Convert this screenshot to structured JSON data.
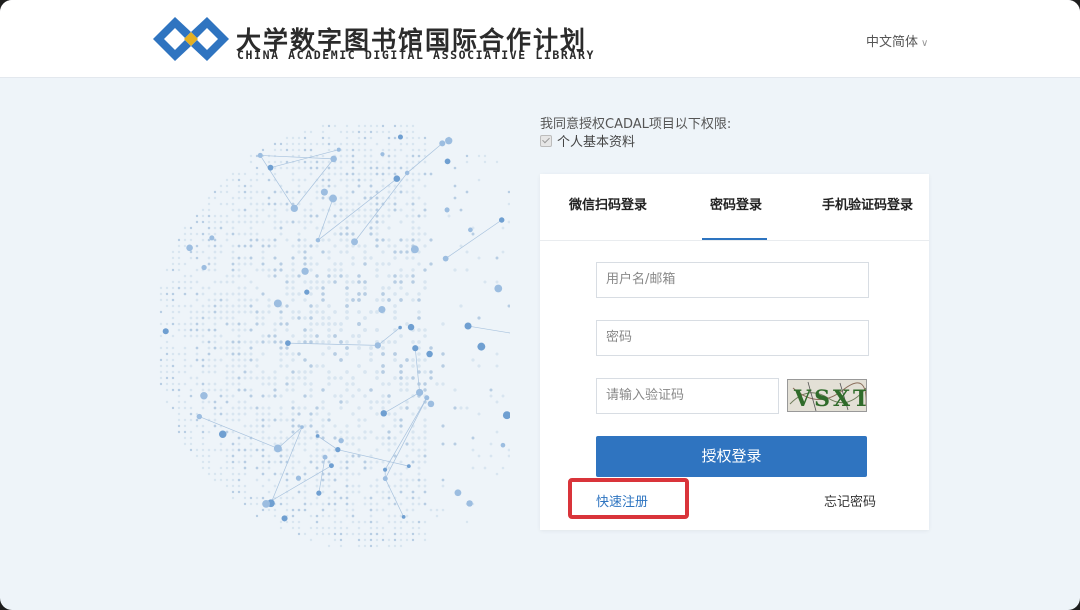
{
  "header": {
    "brand_cn": "大学数字图书馆国际合作计划",
    "brand_en": "CHINA ACADEMIC DIGITAL ASSOCIATIVE LIBRARY",
    "language": "中文简体",
    "colors": {
      "logo_blue": "#2f74c0",
      "logo_gold": "#e5b021"
    }
  },
  "consent": {
    "intro": "我同意授权CADAL项目以下权限:",
    "permission": "个人基本资料",
    "permission_checked": true
  },
  "login": {
    "tabs": [
      {
        "label": "微信扫码登录",
        "active": false
      },
      {
        "label": "密码登录",
        "active": true
      },
      {
        "label": "手机验证码登录",
        "active": false
      }
    ],
    "username_placeholder": "用户名/邮箱",
    "password_placeholder": "密码",
    "captcha_placeholder": "请输入验证码",
    "captcha_text": "VSXT",
    "submit_label": "授权登录",
    "register_label": "快速注册",
    "forgot_label": "忘记密码",
    "accent_color": "#2f74c0",
    "highlight_color": "#d9343a"
  }
}
